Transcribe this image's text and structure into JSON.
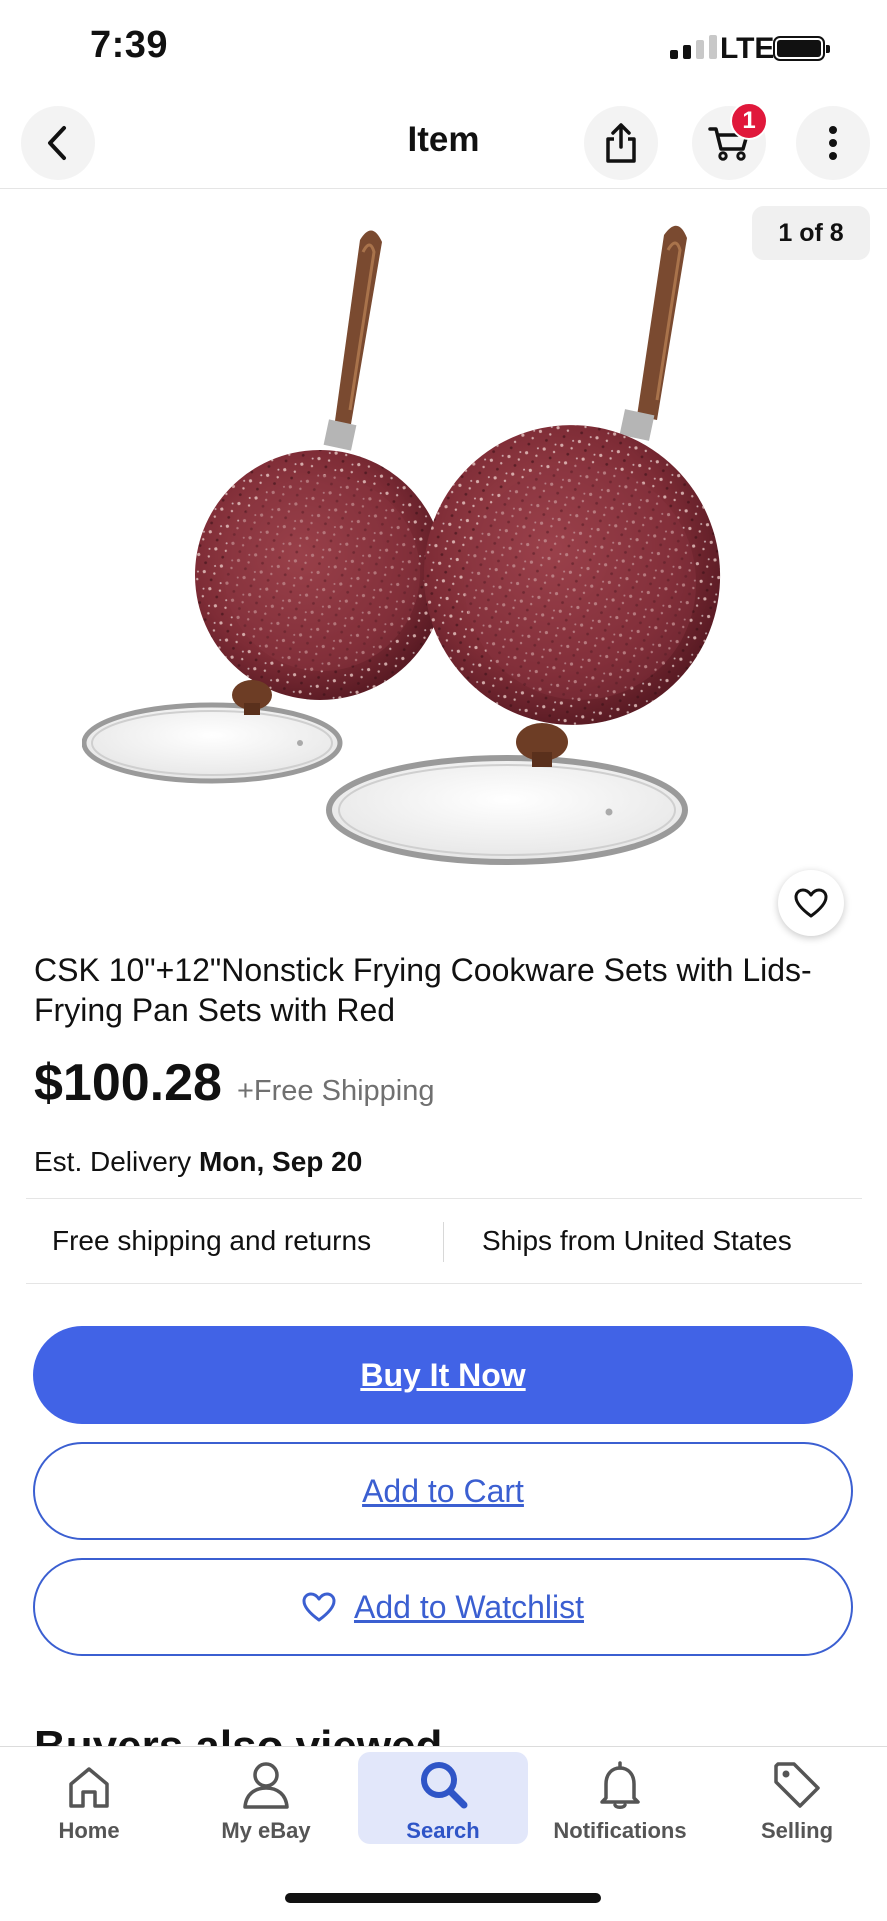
{
  "status_bar": {
    "time": "7:39",
    "network": "LTE"
  },
  "nav": {
    "title": "Item",
    "cart_count": "1",
    "icons": [
      "back-arrow-icon",
      "share-icon",
      "cart-icon",
      "more-vertical-icon"
    ]
  },
  "gallery": {
    "counter": "1 of 8"
  },
  "product": {
    "title": "CSK 10\"+12\"Nonstick Frying Cookware Sets with Lids-Frying Pan Sets with Red",
    "price": "$100.28",
    "shipping_note": "+Free Shipping",
    "delivery_prefix": "Est. Delivery ",
    "delivery_date": "Mon, Sep 20",
    "feature_1": "Free shipping and returns",
    "feature_2": "Ships from United States"
  },
  "actions": {
    "buy_now": "Buy It Now",
    "add_to_cart": "Add to Cart",
    "add_to_watchlist": "Add to Watchlist"
  },
  "section_peek": "Buyers also viewed",
  "tabs": [
    {
      "label": "Home",
      "icon": "home-icon"
    },
    {
      "label": "My eBay",
      "icon": "user-icon"
    },
    {
      "label": "Search",
      "icon": "search-icon",
      "active": true
    },
    {
      "label": "Notifications",
      "icon": "bell-icon"
    },
    {
      "label": "Selling",
      "icon": "tag-icon"
    }
  ],
  "colors": {
    "accent": "#4163e6",
    "link": "#3b5fd1",
    "badge": "#e0183b"
  }
}
